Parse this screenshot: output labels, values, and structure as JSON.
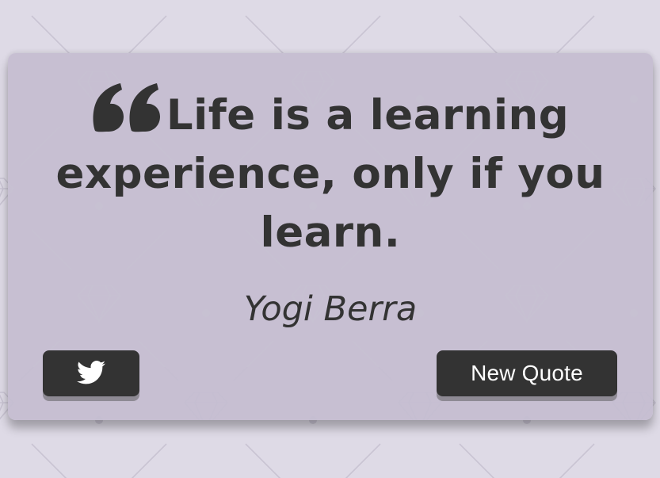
{
  "colors": {
    "background": "#dedae6",
    "card": "#c4bdd0",
    "text": "#333333",
    "button": "#333333",
    "button_text": "#ffffff"
  },
  "quote": {
    "text": "Life is a learning experience, only if you learn.",
    "author": "Yogi Berra",
    "quote_icon": "quote-left-icon"
  },
  "buttons": {
    "tweet_icon": "twitter-icon",
    "new_quote_label": "New Quote"
  }
}
